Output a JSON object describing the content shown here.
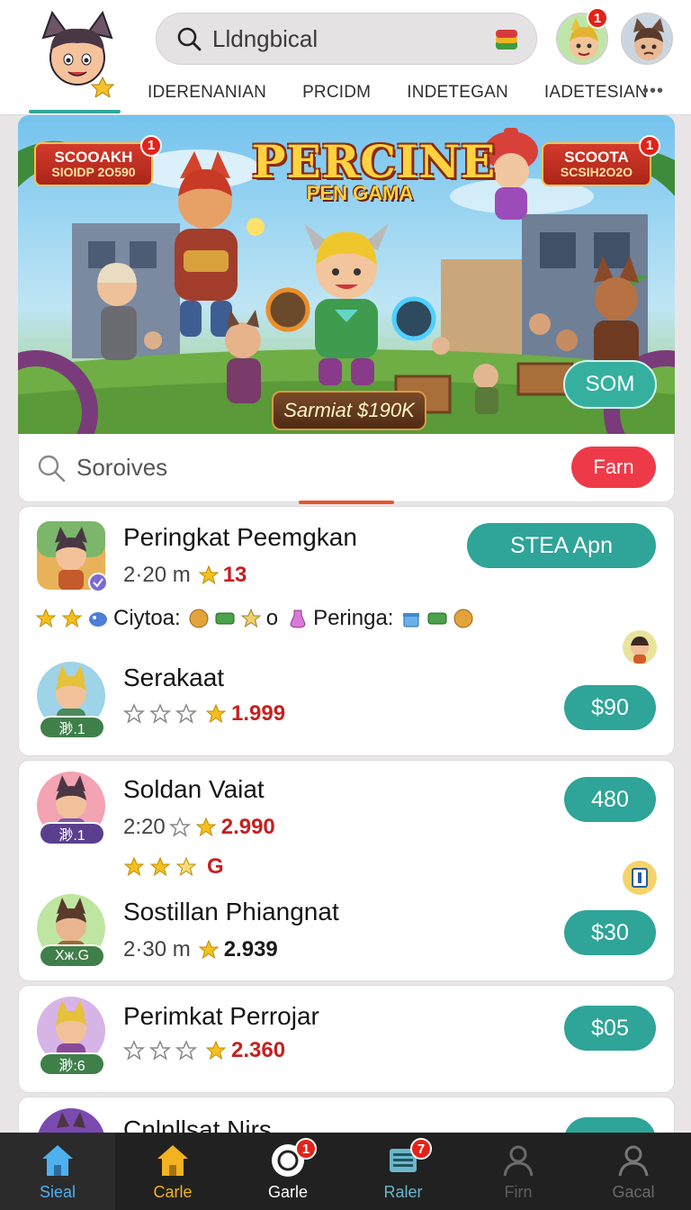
{
  "header": {
    "search_text": "Lldngbical",
    "tabs": [
      "IDERENANIAN",
      "PRCIDM",
      "INDETEGAN",
      "IADETESIAN"
    ],
    "more": "•••",
    "avatar1_badge": "1"
  },
  "banner": {
    "tag_left_1": "SCOOAKH",
    "tag_left_2": "SIOIDP 2O590",
    "tag_left_badge": "1",
    "tag_right_1": "SCOOTA",
    "tag_right_2": "SCSIH2O2O",
    "tag_right_badge": "1",
    "title": "PERCINE",
    "subtitle": "PEN GAMA",
    "plate": "Sarmiat $190K",
    "cta": "SOM"
  },
  "search": {
    "text": "Soroives",
    "button": "Farn"
  },
  "cards": [
    {
      "rows": [
        {
          "name": "Peringkat Peemgkan",
          "time": "2·20 m",
          "score": "13",
          "button": "STEA Apn",
          "extra": {
            "label1": "Ciytoa:",
            "label2": "o",
            "label3": "Peringa:"
          }
        },
        {
          "name": "Serakaat",
          "rank": "渺.1",
          "score": "1.999",
          "button": "$90"
        }
      ]
    },
    {
      "rows": [
        {
          "name": "Soldan Vaiat",
          "rank": "渺.1",
          "time": "2:20",
          "score": "2.990",
          "button": "480",
          "extra_letter": "G"
        },
        {
          "name": "Sostillan Phiangnat",
          "rank": "Хж.G",
          "time": "2·30 m",
          "score": "2.939",
          "button": "$30"
        }
      ]
    },
    {
      "rows": [
        {
          "name": "Perimkat Perrojar",
          "rank": "渺:6",
          "score": "2.360",
          "button": "$05"
        }
      ]
    },
    {
      "rows": [
        {
          "name": "Cnlnllsat Nirs"
        }
      ]
    }
  ],
  "nav": [
    {
      "label": "Sieal",
      "icon": "home-icon",
      "color": "#4fb0ef",
      "badge": ""
    },
    {
      "label": "Carle",
      "icon": "home-icon",
      "color": "#f3b320",
      "badge": ""
    },
    {
      "label": "Garle",
      "icon": "record-icon",
      "color": "#ffffff",
      "badge": "1"
    },
    {
      "label": "Raler",
      "icon": "list-icon",
      "color": "#6bb7c9",
      "badge": "7"
    },
    {
      "label": "Firn",
      "icon": "person-icon",
      "color": "#5d5d5d",
      "badge": ""
    },
    {
      "label": "Gacal",
      "icon": "person-icon",
      "color": "#6a6a6a",
      "badge": ""
    }
  ],
  "colors": {
    "accent": "#2fa498",
    "red_button": "#ee3a48",
    "score_red": "#c62020"
  }
}
